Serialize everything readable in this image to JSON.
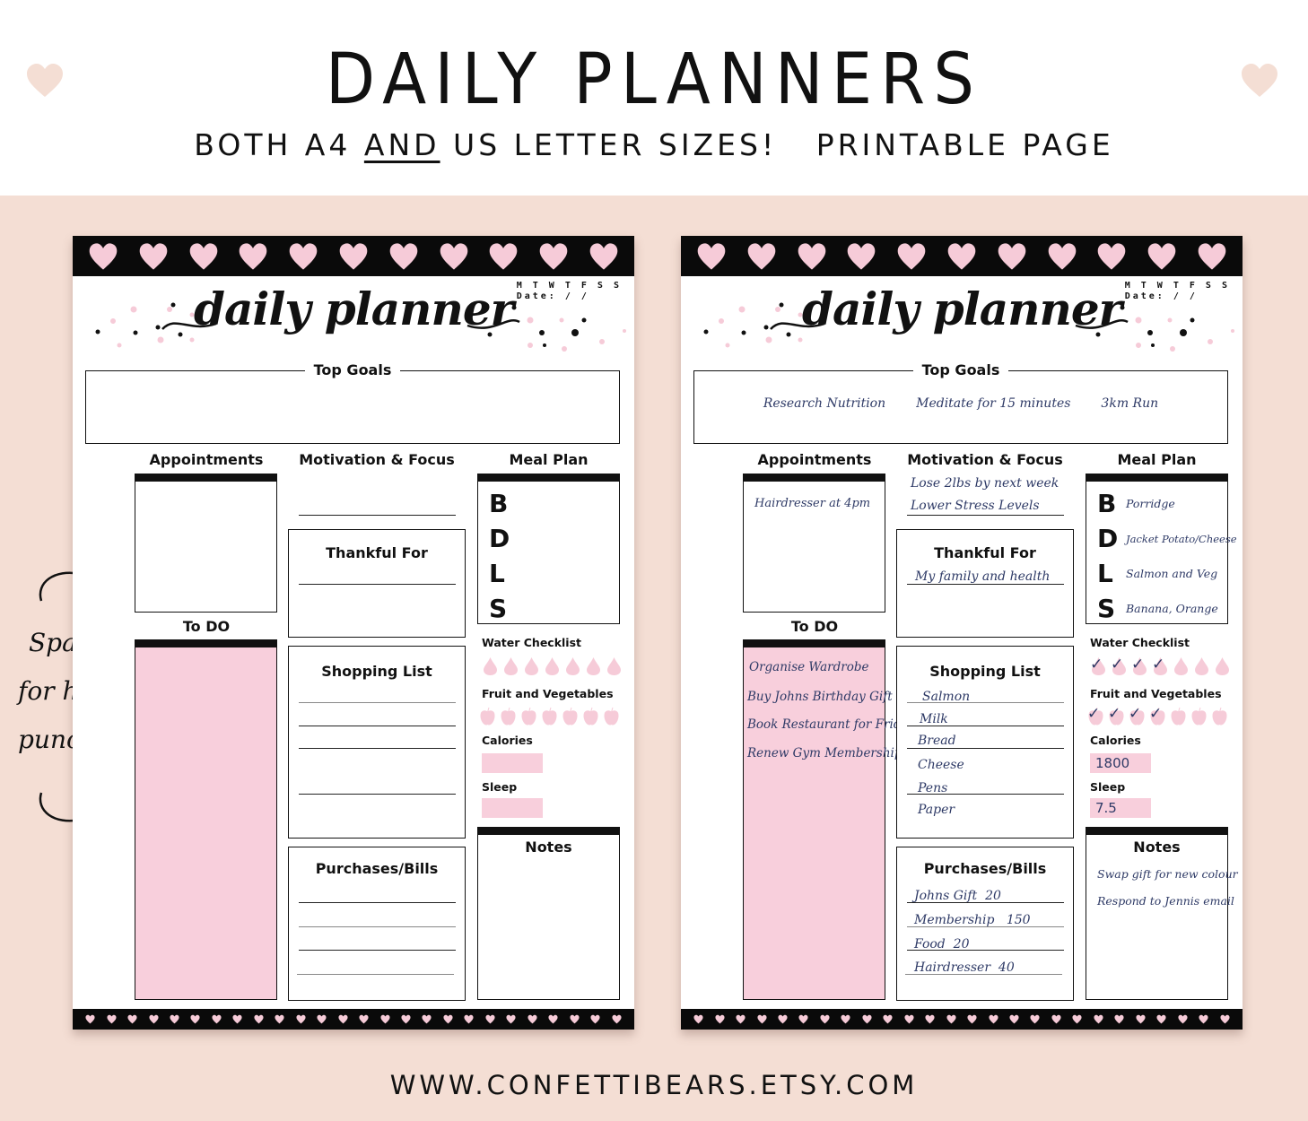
{
  "header": {
    "title": "DAILY PLANNERS",
    "subtitle_part1": "BOTH A4",
    "subtitle_underlined": "AND",
    "subtitle_part2": "US LETTER SIZES!",
    "subtitle_part3": "PRINTABLE PAGE"
  },
  "side_note": {
    "line1": "Space",
    "line2": "for hole",
    "line3": "punching"
  },
  "footer": {
    "url": "WWW.CONFETTIBEARS.ETSY.COM"
  },
  "colors": {
    "background": "#f4ded4",
    "pink": "#f8cfdc",
    "ink": "#2e3a66",
    "black": "#0a0a0a"
  },
  "template": {
    "title": "daily planner",
    "days": "M T W T F S S",
    "date_label": "Date:  /   /",
    "top_goals": "Top Goals",
    "appointments": "Appointments",
    "motivation": "Motivation & Focus",
    "meal_plan": "Meal Plan",
    "meal_letters": [
      "B",
      "D",
      "L",
      "S"
    ],
    "to_do": "To DO",
    "thankful": "Thankful For",
    "shopping": "Shopping List",
    "purchases": "Purchases/Bills",
    "water": "Water Checklist",
    "fruit": "Fruit and Vegetables",
    "calories": "Calories",
    "sleep": "Sleep",
    "notes": "Notes"
  },
  "blank_page": {
    "water_checked": 0,
    "water_total": 7,
    "fruit_checked": 0,
    "fruit_total": 7
  },
  "filled_page": {
    "top_goals": [
      "Research Nutrition",
      "Meditate for 15 minutes",
      "3km Run"
    ],
    "appointments": [
      "Hairdresser at 4pm"
    ],
    "motivation": [
      "Lose 2lbs by next week",
      "Lower Stress Levels"
    ],
    "meals": [
      "Porridge",
      "Jacket Potato/Cheese",
      "Salmon and Veg",
      "Banana, Orange"
    ],
    "thankful": [
      "My family and health"
    ],
    "todo": [
      "Organise Wardrobe",
      "Buy Johns Birthday Gift",
      "Book Restaurant for Friday",
      "Renew Gym Membership"
    ],
    "shopping": [
      "Salmon",
      "Milk",
      "Bread",
      "Cheese",
      "Pens",
      "Paper"
    ],
    "purchases": [
      {
        "item": "Johns Gift",
        "amount": "20"
      },
      {
        "item": "Membership",
        "amount": "150"
      },
      {
        "item": "Food",
        "amount": "20"
      },
      {
        "item": "Hairdresser",
        "amount": "40"
      }
    ],
    "water_checked": 4,
    "water_total": 7,
    "fruit_checked": 4,
    "fruit_total": 7,
    "calories": "1800",
    "sleep": "7.5",
    "notes": [
      "Swap gift for new colour",
      "Respond to Jennis email"
    ]
  }
}
